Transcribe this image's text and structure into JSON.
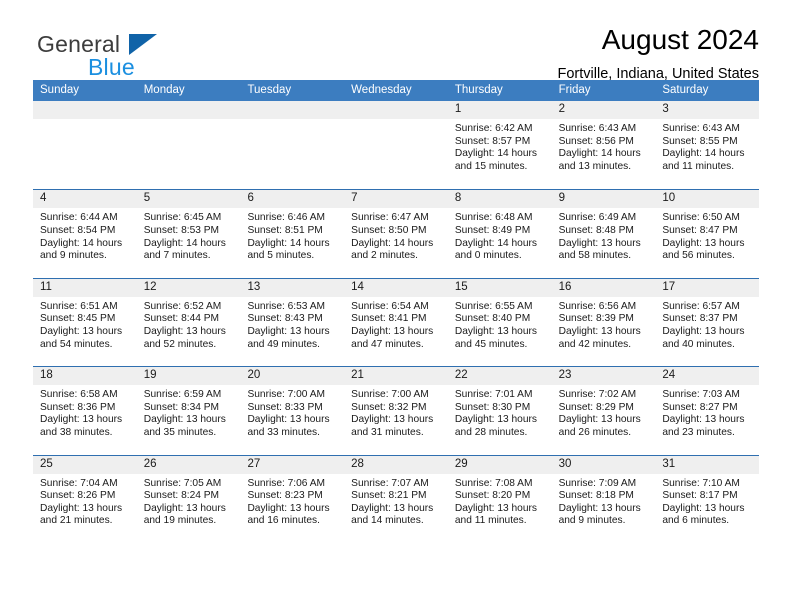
{
  "brand": {
    "name_top": "General",
    "name_bottom": "Blue",
    "triangle_color": "#1063a8",
    "blue_color": "#1b8fe0",
    "gray_color": "#3c3c3c"
  },
  "header": {
    "title": "August 2024",
    "location": "Fortville, Indiana, United States"
  },
  "theme": {
    "header_bar": "#3c7dc0",
    "row_rule": "#2f6fb0",
    "day_band": "#efefef"
  },
  "weekdays": [
    "Sunday",
    "Monday",
    "Tuesday",
    "Wednesday",
    "Thursday",
    "Friday",
    "Saturday"
  ],
  "weeks": [
    [
      {
        "day": "",
        "sunrise": "",
        "sunset": "",
        "daylight_1": "",
        "daylight_2": ""
      },
      {
        "day": "",
        "sunrise": "",
        "sunset": "",
        "daylight_1": "",
        "daylight_2": ""
      },
      {
        "day": "",
        "sunrise": "",
        "sunset": "",
        "daylight_1": "",
        "daylight_2": ""
      },
      {
        "day": "",
        "sunrise": "",
        "sunset": "",
        "daylight_1": "",
        "daylight_2": ""
      },
      {
        "day": "1",
        "sunrise": "Sunrise: 6:42 AM",
        "sunset": "Sunset: 8:57 PM",
        "daylight_1": "Daylight: 14 hours",
        "daylight_2": "and 15 minutes."
      },
      {
        "day": "2",
        "sunrise": "Sunrise: 6:43 AM",
        "sunset": "Sunset: 8:56 PM",
        "daylight_1": "Daylight: 14 hours",
        "daylight_2": "and 13 minutes."
      },
      {
        "day": "3",
        "sunrise": "Sunrise: 6:43 AM",
        "sunset": "Sunset: 8:55 PM",
        "daylight_1": "Daylight: 14 hours",
        "daylight_2": "and 11 minutes."
      }
    ],
    [
      {
        "day": "4",
        "sunrise": "Sunrise: 6:44 AM",
        "sunset": "Sunset: 8:54 PM",
        "daylight_1": "Daylight: 14 hours",
        "daylight_2": "and 9 minutes."
      },
      {
        "day": "5",
        "sunrise": "Sunrise: 6:45 AM",
        "sunset": "Sunset: 8:53 PM",
        "daylight_1": "Daylight: 14 hours",
        "daylight_2": "and 7 minutes."
      },
      {
        "day": "6",
        "sunrise": "Sunrise: 6:46 AM",
        "sunset": "Sunset: 8:51 PM",
        "daylight_1": "Daylight: 14 hours",
        "daylight_2": "and 5 minutes."
      },
      {
        "day": "7",
        "sunrise": "Sunrise: 6:47 AM",
        "sunset": "Sunset: 8:50 PM",
        "daylight_1": "Daylight: 14 hours",
        "daylight_2": "and 2 minutes."
      },
      {
        "day": "8",
        "sunrise": "Sunrise: 6:48 AM",
        "sunset": "Sunset: 8:49 PM",
        "daylight_1": "Daylight: 14 hours",
        "daylight_2": "and 0 minutes."
      },
      {
        "day": "9",
        "sunrise": "Sunrise: 6:49 AM",
        "sunset": "Sunset: 8:48 PM",
        "daylight_1": "Daylight: 13 hours",
        "daylight_2": "and 58 minutes."
      },
      {
        "day": "10",
        "sunrise": "Sunrise: 6:50 AM",
        "sunset": "Sunset: 8:47 PM",
        "daylight_1": "Daylight: 13 hours",
        "daylight_2": "and 56 minutes."
      }
    ],
    [
      {
        "day": "11",
        "sunrise": "Sunrise: 6:51 AM",
        "sunset": "Sunset: 8:45 PM",
        "daylight_1": "Daylight: 13 hours",
        "daylight_2": "and 54 minutes."
      },
      {
        "day": "12",
        "sunrise": "Sunrise: 6:52 AM",
        "sunset": "Sunset: 8:44 PM",
        "daylight_1": "Daylight: 13 hours",
        "daylight_2": "and 52 minutes."
      },
      {
        "day": "13",
        "sunrise": "Sunrise: 6:53 AM",
        "sunset": "Sunset: 8:43 PM",
        "daylight_1": "Daylight: 13 hours",
        "daylight_2": "and 49 minutes."
      },
      {
        "day": "14",
        "sunrise": "Sunrise: 6:54 AM",
        "sunset": "Sunset: 8:41 PM",
        "daylight_1": "Daylight: 13 hours",
        "daylight_2": "and 47 minutes."
      },
      {
        "day": "15",
        "sunrise": "Sunrise: 6:55 AM",
        "sunset": "Sunset: 8:40 PM",
        "daylight_1": "Daylight: 13 hours",
        "daylight_2": "and 45 minutes."
      },
      {
        "day": "16",
        "sunrise": "Sunrise: 6:56 AM",
        "sunset": "Sunset: 8:39 PM",
        "daylight_1": "Daylight: 13 hours",
        "daylight_2": "and 42 minutes."
      },
      {
        "day": "17",
        "sunrise": "Sunrise: 6:57 AM",
        "sunset": "Sunset: 8:37 PM",
        "daylight_1": "Daylight: 13 hours",
        "daylight_2": "and 40 minutes."
      }
    ],
    [
      {
        "day": "18",
        "sunrise": "Sunrise: 6:58 AM",
        "sunset": "Sunset: 8:36 PM",
        "daylight_1": "Daylight: 13 hours",
        "daylight_2": "and 38 minutes."
      },
      {
        "day": "19",
        "sunrise": "Sunrise: 6:59 AM",
        "sunset": "Sunset: 8:34 PM",
        "daylight_1": "Daylight: 13 hours",
        "daylight_2": "and 35 minutes."
      },
      {
        "day": "20",
        "sunrise": "Sunrise: 7:00 AM",
        "sunset": "Sunset: 8:33 PM",
        "daylight_1": "Daylight: 13 hours",
        "daylight_2": "and 33 minutes."
      },
      {
        "day": "21",
        "sunrise": "Sunrise: 7:00 AM",
        "sunset": "Sunset: 8:32 PM",
        "daylight_1": "Daylight: 13 hours",
        "daylight_2": "and 31 minutes."
      },
      {
        "day": "22",
        "sunrise": "Sunrise: 7:01 AM",
        "sunset": "Sunset: 8:30 PM",
        "daylight_1": "Daylight: 13 hours",
        "daylight_2": "and 28 minutes."
      },
      {
        "day": "23",
        "sunrise": "Sunrise: 7:02 AM",
        "sunset": "Sunset: 8:29 PM",
        "daylight_1": "Daylight: 13 hours",
        "daylight_2": "and 26 minutes."
      },
      {
        "day": "24",
        "sunrise": "Sunrise: 7:03 AM",
        "sunset": "Sunset: 8:27 PM",
        "daylight_1": "Daylight: 13 hours",
        "daylight_2": "and 23 minutes."
      }
    ],
    [
      {
        "day": "25",
        "sunrise": "Sunrise: 7:04 AM",
        "sunset": "Sunset: 8:26 PM",
        "daylight_1": "Daylight: 13 hours",
        "daylight_2": "and 21 minutes."
      },
      {
        "day": "26",
        "sunrise": "Sunrise: 7:05 AM",
        "sunset": "Sunset: 8:24 PM",
        "daylight_1": "Daylight: 13 hours",
        "daylight_2": "and 19 minutes."
      },
      {
        "day": "27",
        "sunrise": "Sunrise: 7:06 AM",
        "sunset": "Sunset: 8:23 PM",
        "daylight_1": "Daylight: 13 hours",
        "daylight_2": "and 16 minutes."
      },
      {
        "day": "28",
        "sunrise": "Sunrise: 7:07 AM",
        "sunset": "Sunset: 8:21 PM",
        "daylight_1": "Daylight: 13 hours",
        "daylight_2": "and 14 minutes."
      },
      {
        "day": "29",
        "sunrise": "Sunrise: 7:08 AM",
        "sunset": "Sunset: 8:20 PM",
        "daylight_1": "Daylight: 13 hours",
        "daylight_2": "and 11 minutes."
      },
      {
        "day": "30",
        "sunrise": "Sunrise: 7:09 AM",
        "sunset": "Sunset: 8:18 PM",
        "daylight_1": "Daylight: 13 hours",
        "daylight_2": "and 9 minutes."
      },
      {
        "day": "31",
        "sunrise": "Sunrise: 7:10 AM",
        "sunset": "Sunset: 8:17 PM",
        "daylight_1": "Daylight: 13 hours",
        "daylight_2": "and 6 minutes."
      }
    ]
  ]
}
